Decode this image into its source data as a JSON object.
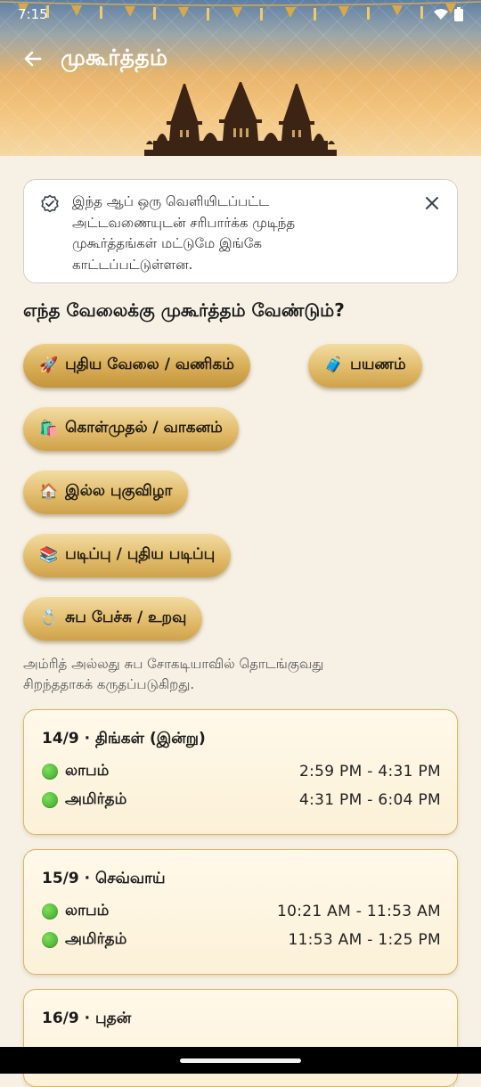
{
  "status_bar": {
    "time": "7:15"
  },
  "header": {
    "title": "முகூர்த்தம்"
  },
  "notice": {
    "lines": [
      "இந்த ஆப் ஒரு வெளியிடப்பட்ட",
      "அட்டவணையுடன் சரிபார்க்க முடிந்த",
      "முகூர்த்தங்கள் மட்டுமே இங்கே",
      "காட்டப்பட்டுள்ளன."
    ]
  },
  "question": "எந்த வேலைக்கு முகூர்த்தம் வேண்டும்?",
  "categories": [
    {
      "emoji": "🚀",
      "label": "புதிய வேலை / வணிகம்",
      "selected": true
    },
    {
      "emoji": "🧳",
      "label": "பயணம்",
      "selected": false
    },
    {
      "emoji": "🛍️",
      "label": "கொள்முதல் / வாகனம்",
      "selected": false
    },
    {
      "emoji": "🏠",
      "label": "இல்ல புகுவிழா",
      "selected": false
    },
    {
      "emoji": "📚",
      "label": "படிப்பு / புதிய படிப்பு",
      "selected": false
    },
    {
      "emoji": "💍",
      "label": "சுப பேச்சு / உறவு",
      "selected": false
    }
  ],
  "hint": {
    "lines": [
      "அம்ரித் அல்லது சுப சோகடியாவில் தொடங்குவது",
      "சிறந்ததாகக் கருதப்படுகிறது."
    ]
  },
  "days": [
    {
      "title": "14/9 · திங்கள் (இன்று)",
      "slots": [
        {
          "name": "லாபம்",
          "time": "2:59 PM - 4:31 PM"
        },
        {
          "name": "அமிர்தம்",
          "time": "4:31 PM - 6:04 PM"
        }
      ]
    },
    {
      "title": "15/9 · செவ்வாய்",
      "slots": [
        {
          "name": "லாபம்",
          "time": "10:21 AM - 11:53 AM"
        },
        {
          "name": "அமிர்தம்",
          "time": "11:53 AM - 1:25 PM"
        }
      ]
    },
    {
      "title": "16/9 · புதன்",
      "slots": []
    }
  ],
  "colors": {
    "accent_gold": "#d7ac55",
    "slot_dot_green": "#3aa126",
    "page_background": "#f7f1e5"
  }
}
